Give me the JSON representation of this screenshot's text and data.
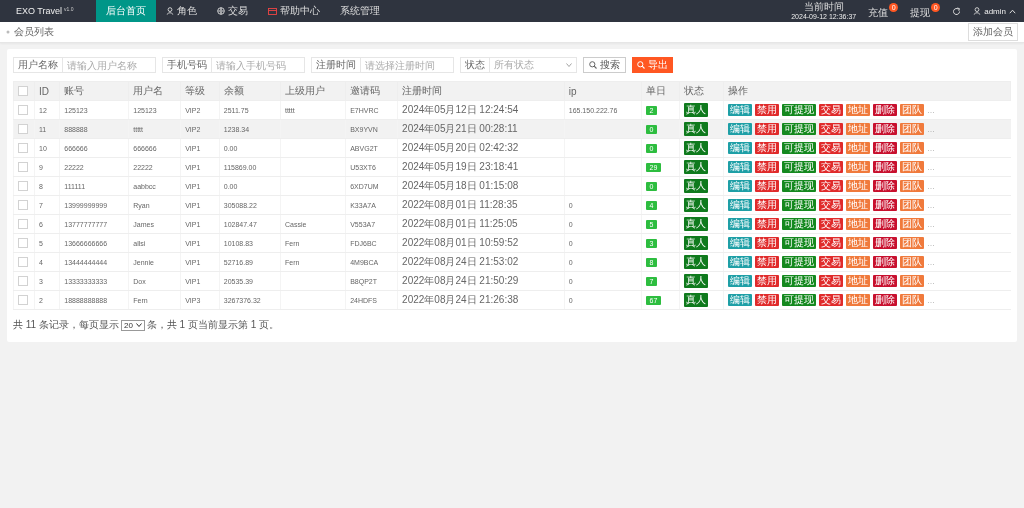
{
  "header": {
    "brand": "EXO Travel",
    "version": "v1.0",
    "nav": [
      {
        "label": "后台首页",
        "selected": true
      },
      {
        "label": "角色",
        "selected": false
      },
      {
        "label": "交易",
        "selected": false
      },
      {
        "label": "帮助中心",
        "selected": false
      },
      {
        "label": "系统管理",
        "selected": false
      }
    ],
    "clock_label": "当前时间",
    "clock": "2024-09-12 12:36:37",
    "counters": [
      {
        "label": "充值",
        "badge": "0"
      },
      {
        "label": "提现",
        "badge": "0"
      }
    ],
    "user": "admin"
  },
  "breadcrumb": "会员列表",
  "add_button": "添加会员",
  "filters": [
    {
      "kind": "text",
      "label": "用户名称",
      "placeholder": "请输入用户名称"
    },
    {
      "kind": "text",
      "label": "手机号码",
      "placeholder": "请输入手机号码"
    },
    {
      "kind": "text",
      "label": "注册时间",
      "placeholder": "请选择注册时间"
    },
    {
      "kind": "select",
      "label": "状态",
      "value": "所有状态"
    }
  ],
  "search_button": "搜索",
  "export_button": "导出",
  "table": {
    "all_checked": false,
    "columns": [
      "ID",
      "账号",
      "用户名",
      "等级",
      "余额",
      "上级用户",
      "邀请码",
      "注册时间",
      "ip",
      "单日",
      "状态",
      "操作"
    ],
    "rows": [
      {
        "checked": false,
        "selected": false,
        "id": "12",
        "account": "125123",
        "username": "125123",
        "level": "VIP2",
        "balance": "2511.75",
        "parent": "ttttt",
        "invite_code": "E7HVRC",
        "registered": "2024年05月12日 12:24:54",
        "ip": "165.150.222.76",
        "daily": "2",
        "status": "真人",
        "more": "…",
        "actions": [
          {
            "kind": "edit",
            "label": "编辑"
          },
          {
            "kind": "disable",
            "label": "禁用"
          },
          {
            "kind": "withdraw",
            "label": "可提现"
          },
          {
            "kind": "trade",
            "label": "交易"
          },
          {
            "kind": "address",
            "label": "地址"
          },
          {
            "kind": "delete",
            "label": "删除"
          },
          {
            "kind": "team",
            "label": "团队"
          }
        ]
      },
      {
        "checked": false,
        "selected": true,
        "id": "11",
        "account": "888888",
        "username": "ttttt",
        "level": "VIP2",
        "balance": "1238.34",
        "invite_code": "BX9YVN",
        "registered": "2024年05月21日 00:28:11",
        "daily": "0",
        "status": "真人",
        "more": "…",
        "actions": [
          {
            "kind": "edit",
            "label": "编辑"
          },
          {
            "kind": "disable",
            "label": "禁用"
          },
          {
            "kind": "withdraw",
            "label": "可提现"
          },
          {
            "kind": "trade",
            "label": "交易"
          },
          {
            "kind": "address",
            "label": "地址"
          },
          {
            "kind": "delete",
            "label": "删除"
          },
          {
            "kind": "team",
            "label": "团队"
          }
        ]
      },
      {
        "checked": false,
        "selected": false,
        "id": "10",
        "account": "666666",
        "username": "666666",
        "level": "VIP1",
        "balance": "0.00",
        "invite_code": "ABVG2T",
        "registered": "2024年05月20日 02:42:32",
        "daily": "0",
        "status": "真人",
        "more": "…",
        "actions": [
          {
            "kind": "edit",
            "label": "编辑"
          },
          {
            "kind": "disable",
            "label": "禁用"
          },
          {
            "kind": "withdraw",
            "label": "可提现"
          },
          {
            "kind": "trade",
            "label": "交易"
          },
          {
            "kind": "address",
            "label": "地址"
          },
          {
            "kind": "delete",
            "label": "删除"
          },
          {
            "kind": "team",
            "label": "团队"
          }
        ]
      },
      {
        "checked": false,
        "selected": false,
        "id": "9",
        "account": "22222",
        "username": "22222",
        "level": "VIP1",
        "balance": "115869.00",
        "invite_code": "U53XT6",
        "registered": "2024年05月19日 23:18:41",
        "daily": "29",
        "status": "真人",
        "more": "…",
        "actions": [
          {
            "kind": "edit",
            "label": "编辑"
          },
          {
            "kind": "disable",
            "label": "禁用"
          },
          {
            "kind": "withdraw",
            "label": "可提现"
          },
          {
            "kind": "trade",
            "label": "交易"
          },
          {
            "kind": "address",
            "label": "地址"
          },
          {
            "kind": "delete",
            "label": "删除"
          },
          {
            "kind": "team",
            "label": "团队"
          }
        ]
      },
      {
        "checked": false,
        "selected": false,
        "id": "8",
        "account": "111111",
        "username": "aabbcc",
        "level": "VIP1",
        "balance": "0.00",
        "invite_code": "6XD7UM",
        "registered": "2024年05月18日 01:15:08",
        "daily": "0",
        "status": "真人",
        "more": "…",
        "actions": [
          {
            "kind": "edit",
            "label": "编辑"
          },
          {
            "kind": "disable",
            "label": "禁用"
          },
          {
            "kind": "withdraw",
            "label": "可提现"
          },
          {
            "kind": "trade",
            "label": "交易"
          },
          {
            "kind": "address",
            "label": "地址"
          },
          {
            "kind": "delete",
            "label": "删除"
          },
          {
            "kind": "team",
            "label": "团队"
          }
        ]
      },
      {
        "checked": false,
        "selected": false,
        "id": "7",
        "account": "13999999999",
        "username": "Ryan",
        "level": "VIP1",
        "balance": "305088.22",
        "invite_code": "K33A7A",
        "registered": "2022年08月01日 11:28:35",
        "ip": "0",
        "daily": "4",
        "status": "真人",
        "more": "…",
        "actions": [
          {
            "kind": "edit",
            "label": "编辑"
          },
          {
            "kind": "disable",
            "label": "禁用"
          },
          {
            "kind": "withdraw",
            "label": "可提现"
          },
          {
            "kind": "trade",
            "label": "交易"
          },
          {
            "kind": "address",
            "label": "地址"
          },
          {
            "kind": "delete",
            "label": "删除"
          },
          {
            "kind": "team",
            "label": "团队"
          }
        ]
      },
      {
        "checked": false,
        "selected": false,
        "id": "6",
        "account": "13777777777",
        "username": "James",
        "level": "VIP1",
        "balance": "102847.47",
        "parent": "Cassie",
        "invite_code": "V553A7",
        "registered": "2022年08月01日 11:25:05",
        "ip": "0",
        "daily": "5",
        "status": "真人",
        "more": "…",
        "actions": [
          {
            "kind": "edit",
            "label": "编辑"
          },
          {
            "kind": "disable",
            "label": "禁用"
          },
          {
            "kind": "withdraw",
            "label": "可提现"
          },
          {
            "kind": "trade",
            "label": "交易"
          },
          {
            "kind": "address",
            "label": "地址"
          },
          {
            "kind": "delete",
            "label": "删除"
          },
          {
            "kind": "team",
            "label": "团队"
          }
        ]
      },
      {
        "checked": false,
        "selected": false,
        "id": "5",
        "account": "13666666666",
        "username": "allsi",
        "level": "VIP1",
        "balance": "10108.83",
        "parent": "Fern",
        "invite_code": "FDJ6BC",
        "registered": "2022年08月01日 10:59:52",
        "ip": "0",
        "daily": "3",
        "status": "真人",
        "more": "…",
        "actions": [
          {
            "kind": "edit",
            "label": "编辑"
          },
          {
            "kind": "disable",
            "label": "禁用"
          },
          {
            "kind": "withdraw",
            "label": "可提现"
          },
          {
            "kind": "trade",
            "label": "交易"
          },
          {
            "kind": "address",
            "label": "地址"
          },
          {
            "kind": "delete",
            "label": "删除"
          },
          {
            "kind": "team",
            "label": "团队"
          }
        ]
      },
      {
        "checked": false,
        "selected": false,
        "id": "4",
        "account": "13444444444",
        "username": "Jennie",
        "level": "VIP1",
        "balance": "52716.89",
        "parent": "Fern",
        "invite_code": "4M9BCA",
        "registered": "2022年08月24日 21:53:02",
        "ip": "0",
        "daily": "8",
        "status": "真人",
        "more": "…",
        "actions": [
          {
            "kind": "edit",
            "label": "编辑"
          },
          {
            "kind": "disable",
            "label": "禁用"
          },
          {
            "kind": "withdraw",
            "label": "可提现"
          },
          {
            "kind": "trade",
            "label": "交易"
          },
          {
            "kind": "address",
            "label": "地址"
          },
          {
            "kind": "delete",
            "label": "删除"
          },
          {
            "kind": "team",
            "label": "团队"
          }
        ]
      },
      {
        "checked": false,
        "selected": false,
        "id": "3",
        "account": "13333333333",
        "username": "Dox",
        "level": "VIP1",
        "balance": "20535.39",
        "invite_code": "B8QP2T",
        "registered": "2022年08月24日 21:50:29",
        "ip": "0",
        "daily": "7",
        "status": "真人",
        "more": "…",
        "actions": [
          {
            "kind": "edit",
            "label": "编辑"
          },
          {
            "kind": "disable",
            "label": "禁用"
          },
          {
            "kind": "withdraw",
            "label": "可提现"
          },
          {
            "kind": "trade",
            "label": "交易"
          },
          {
            "kind": "address",
            "label": "地址"
          },
          {
            "kind": "delete",
            "label": "删除"
          },
          {
            "kind": "team",
            "label": "团队"
          }
        ]
      },
      {
        "checked": false,
        "selected": false,
        "id": "2",
        "account": "18888888888",
        "username": "Fern",
        "level": "VIP3",
        "balance": "3267376.32",
        "invite_code": "24HDFS",
        "registered": "2022年08月24日 21:26:38",
        "ip": "0",
        "daily": "67",
        "status": "真人",
        "more": "…",
        "actions": [
          {
            "kind": "edit",
            "label": "编辑"
          },
          {
            "kind": "disable",
            "label": "禁用"
          },
          {
            "kind": "withdraw",
            "label": "可提现"
          },
          {
            "kind": "trade",
            "label": "交易"
          },
          {
            "kind": "address",
            "label": "地址"
          },
          {
            "kind": "delete",
            "label": "删除"
          },
          {
            "kind": "team",
            "label": "团队"
          }
        ]
      }
    ]
  },
  "pager": {
    "before": "共 11 条记录，每页显示",
    "page_size": "20",
    "after": "条，共 1 页当前显示第 1 页。"
  }
}
